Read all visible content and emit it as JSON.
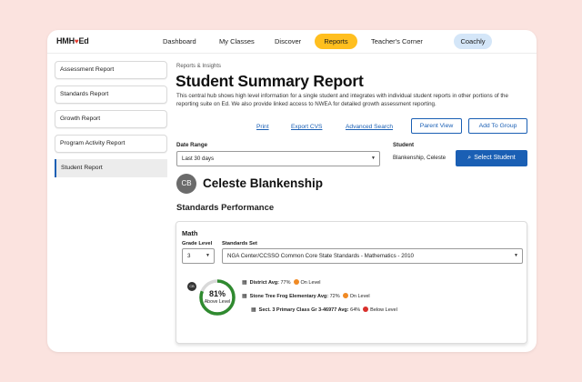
{
  "colors": {
    "accent": "#1a5fb4",
    "reports_pill": "#ffbf1f",
    "coachly_pill": "#d4e6f8",
    "on_level": "#f08a24",
    "below_level": "#d9302c",
    "ring": "#2f8a2f"
  },
  "nav": {
    "logo": "HMH",
    "logo_suffix": "Ed",
    "items": [
      "Dashboard",
      "My Classes",
      "Discover",
      "Reports",
      "Teacher's Corner",
      "Coachly"
    ]
  },
  "sidebar": {
    "items": [
      {
        "label": "Assessment Report"
      },
      {
        "label": "Standards Report"
      },
      {
        "label": "Growth Report"
      },
      {
        "label": "Program Activity Report"
      },
      {
        "label": "Student Report"
      }
    ]
  },
  "page": {
    "breadcrumb": "Reports & Insights",
    "title": "Student Summary Report",
    "description": "This central hub shows high level information for a single student and integrates with individual student reports in other portions of the reporting suite on Ed. We also provide linked access to NWEA for detailed growth assessment reporting."
  },
  "actions": {
    "print": "Print",
    "export": "Export CVS",
    "advanced_search": "Advanced Search",
    "parent_view": "Parent View",
    "add_to_group": "Add To Group"
  },
  "filters": {
    "date_range_label": "Date Range",
    "date_range_value": "Last 30 days",
    "student_label": "Student",
    "student_value": "Blankenship, Celeste",
    "select_student": "Select Student"
  },
  "student": {
    "initials": "CB",
    "name": "Celeste Blankenship"
  },
  "standards": {
    "section_title": "Standards Performance",
    "subject": "Math",
    "grade_level_label": "Grade Level",
    "grade_level_value": "3",
    "standards_set_label": "Standards Set",
    "standards_set_value": "NGA Center/CCSSO Common Core State Standards - Mathematics - 2010",
    "badge": "CB",
    "score": "81%",
    "score_fraction": 0.81,
    "score_label": "Above Level",
    "averages": [
      {
        "name": "District Avg:",
        "value": "77%",
        "status": "On Level",
        "status_key": "on_level"
      },
      {
        "name": "Stone Tree Frog Elementary Avg:",
        "value": "72%",
        "status": "On Level",
        "status_key": "on_level"
      },
      {
        "name": "Sect. 3 Primary Class Gr 3-46977 Avg:",
        "value": "64%",
        "status": "Below Level",
        "status_key": "below_level"
      }
    ]
  }
}
